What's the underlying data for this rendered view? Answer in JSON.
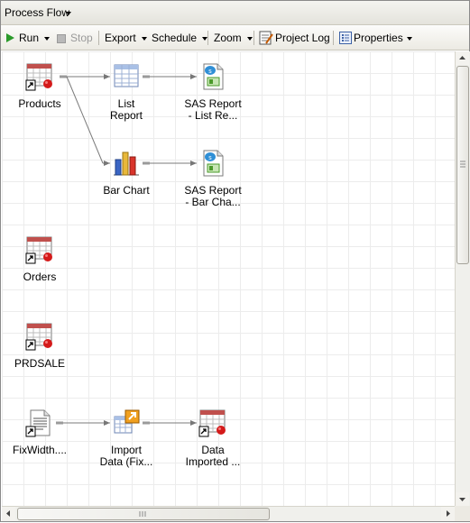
{
  "title": "Process Flow",
  "toolbar": {
    "run": "Run",
    "stop": "Stop",
    "export": "Export",
    "schedule": "Schedule",
    "zoom": "Zoom",
    "project_log": "Project Log",
    "properties": "Properties"
  },
  "nodes": {
    "products": "Products",
    "list_report": [
      "List",
      "Report"
    ],
    "sas_list": [
      "SAS Report",
      "- List Re..."
    ],
    "bar_chart": "Bar Chart",
    "sas_bar": [
      "SAS Report",
      "- Bar Cha..."
    ],
    "orders": "Orders",
    "prdsale": "PRDSALE",
    "fixwidth": "FixWidth....",
    "import_data": [
      "Import",
      "Data (Fix..."
    ],
    "data_imported": [
      "Data",
      "Imported ..."
    ]
  },
  "colors": {
    "grid": "#ececec",
    "link": "#707070",
    "run_green": "#2a9a2a",
    "red_dot": "#d41a1a"
  }
}
